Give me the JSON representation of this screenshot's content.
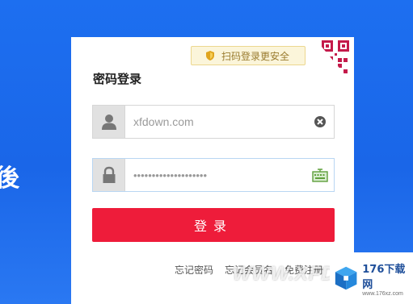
{
  "background": {
    "side_glyph": "後",
    "color": "#1a66e8"
  },
  "card": {
    "qr_tip": {
      "text": "扫码登录更安全",
      "icon": "shield-icon"
    },
    "qr_corner_icon": "qr-code-icon",
    "title": "密码登录",
    "username": {
      "value": "xfdown.com",
      "icon": "user-icon",
      "clear_icon": "clear-icon"
    },
    "password": {
      "value": "••••••••••••••••••••",
      "icon": "lock-icon",
      "keyboard_icon": "keyboard-icon"
    },
    "login_button": {
      "label": "登录",
      "color": "#ee1c3a"
    },
    "links": [
      "忘记密码",
      "忘记会员名",
      "免费注册"
    ]
  },
  "watermark": {
    "text": "WWW.XFDO"
  },
  "logo_badge": {
    "main": "176下载网",
    "sub": "www.176xz.com"
  }
}
